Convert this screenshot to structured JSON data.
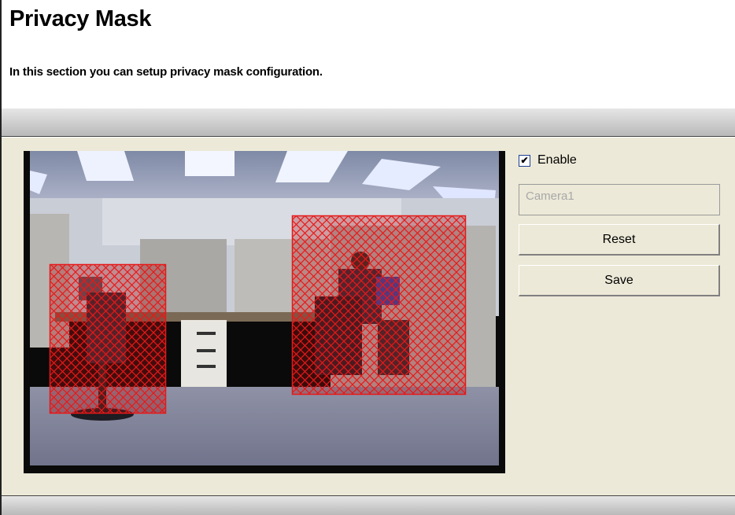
{
  "header": {
    "title": "Privacy Mask",
    "description": "In this section you can setup privacy mask configuration."
  },
  "video": {
    "mask_color": "#e81818",
    "mask_count": 2,
    "mask_masks": [
      "mask-region-left",
      "mask-region-right"
    ]
  },
  "controls": {
    "enable_checked": true,
    "enable_label": "Enable",
    "camera_name": "Camera1",
    "reset_label": "Reset",
    "save_label": "Save"
  }
}
